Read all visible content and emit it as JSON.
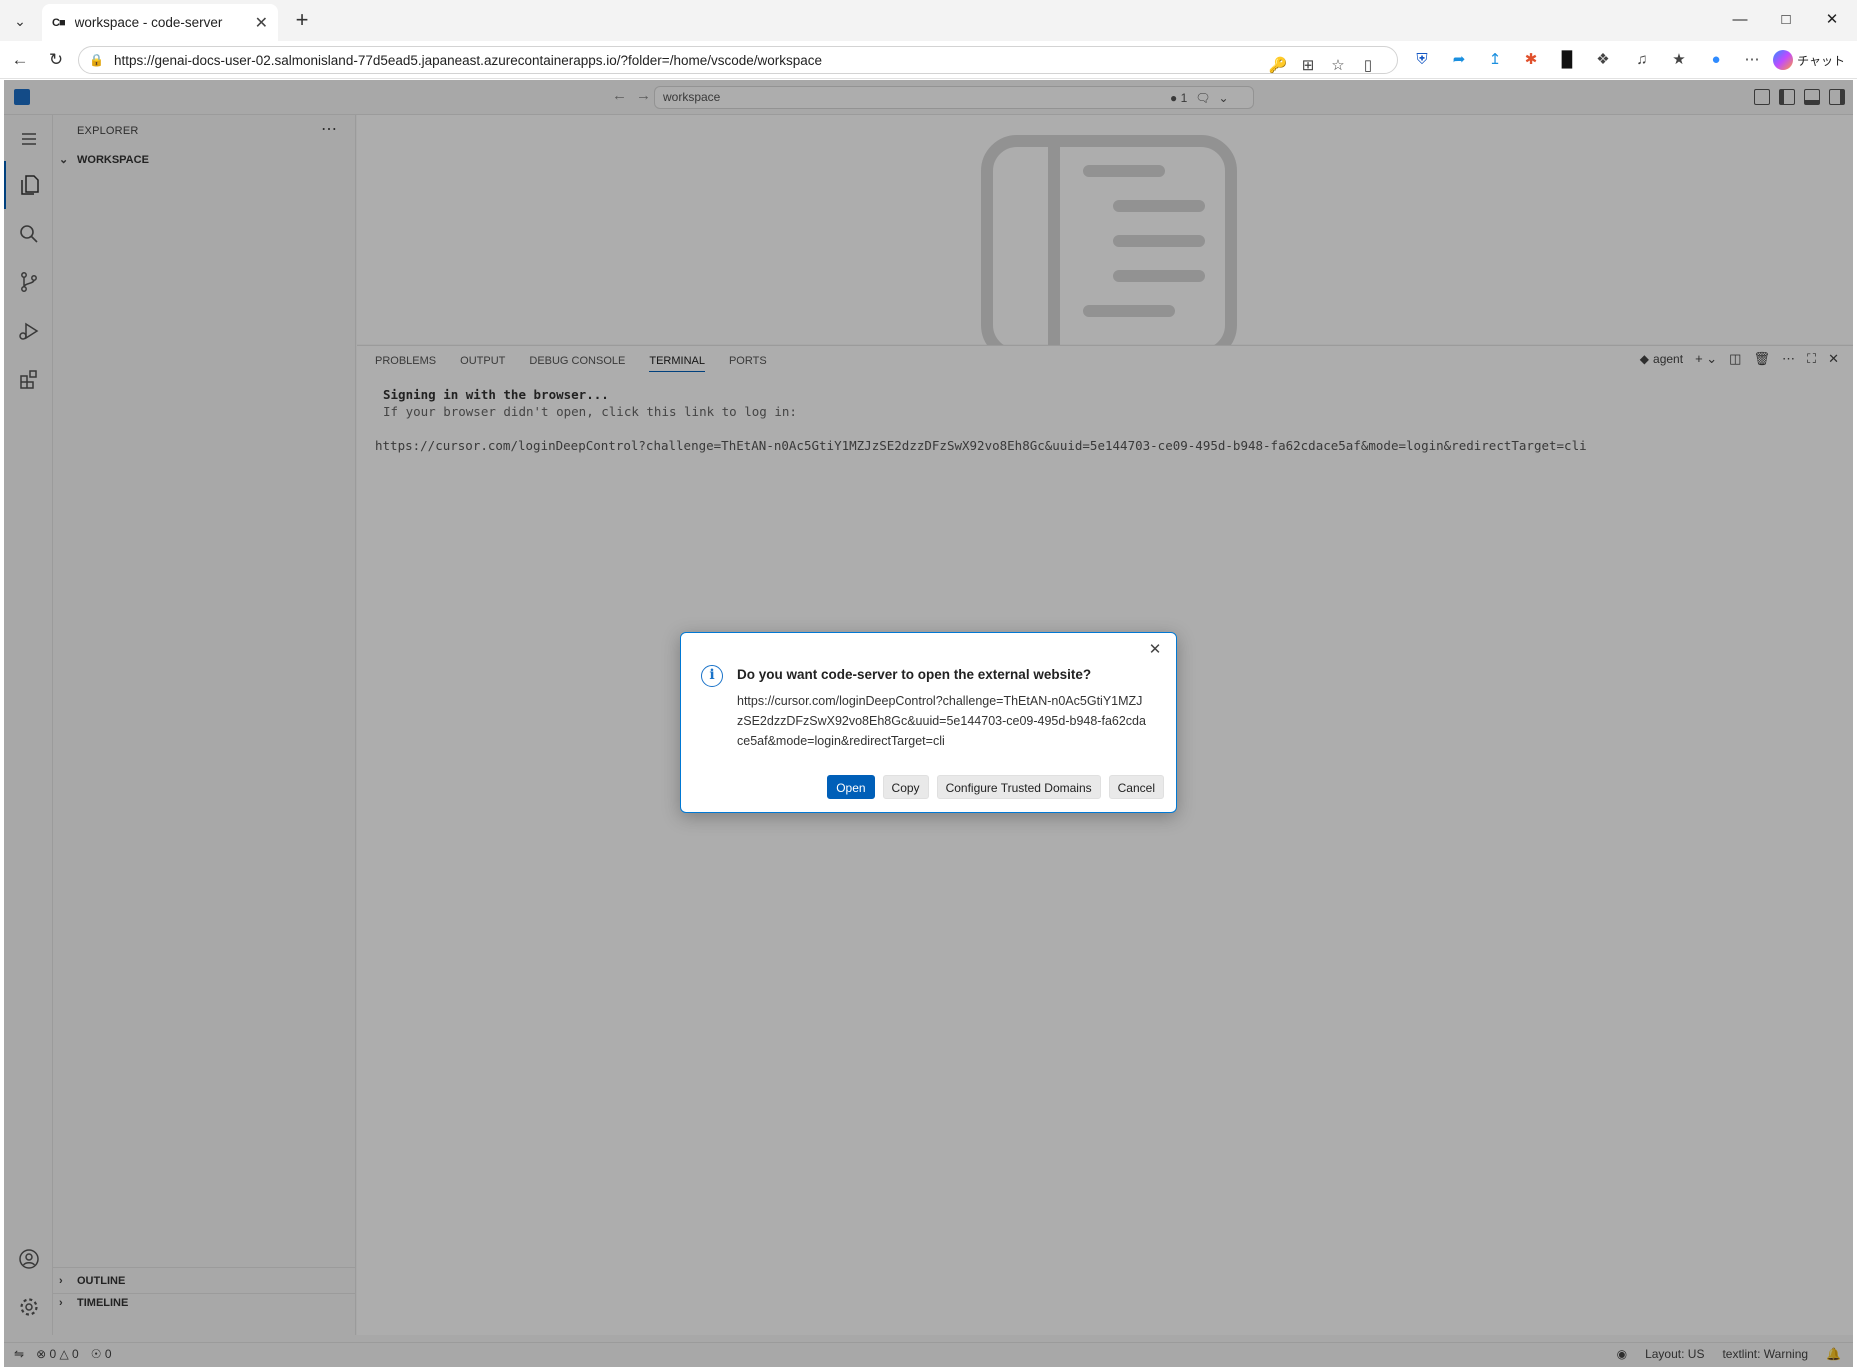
{
  "browser": {
    "tab_title": "workspace - code-server",
    "tab_favicon": "C■",
    "url": "https://genai-docs-user-02.salmonisland-77d5ead5.japaneast.azurecontainerapps.io/?folder=/home/vscode/workspace",
    "copilot_label": "チャット"
  },
  "vscode": {
    "titlebar": {
      "search_text": "workspace",
      "notification_count": "1"
    },
    "sidebar": {
      "header": "EXPLORER",
      "workspace_section": "WORKSPACE",
      "outline_section": "OUTLINE",
      "timeline_section": "TIMELINE"
    },
    "panel": {
      "tabs": [
        "PROBLEMS",
        "OUTPUT",
        "DEBUG CONSOLE",
        "TERMINAL",
        "PORTS"
      ],
      "terminal_name": "agent",
      "terminal_lines": [
        "Signing in with the browser...",
        "If your browser didn't open, click this link to log in:",
        "https://cursor.com/loginDeepControl?challenge=ThEtAN-n0Ac5GtiY1MZJzSE2dzzDFzSwX92vo8Eh8Gc&uuid=5e144703-ce09-495d-b948-fa62cdace5af&mode=login&redirectTarget=cli"
      ]
    },
    "statusbar": {
      "errors": "0",
      "warnings": "0",
      "ports": "0",
      "layout": "Layout: US",
      "textlint": "textlint: Warning"
    }
  },
  "dialog": {
    "title": "Do you want code-server to open the external website?",
    "message": "https://cursor.com/loginDeepControl?challenge=ThEtAN-n0Ac5GtiY1MZJzSE2dzzDFzSwX92vo8Eh8Gc&uuid=5e144703-ce09-495d-b948-fa62cdace5af&mode=login&redirectTarget=cli",
    "buttons": {
      "open": "Open",
      "copy": "Copy",
      "configure": "Configure Trusted Domains",
      "cancel": "Cancel"
    }
  },
  "colors": {
    "accent": "#005fb8",
    "dialog_border": "#0078d4"
  }
}
